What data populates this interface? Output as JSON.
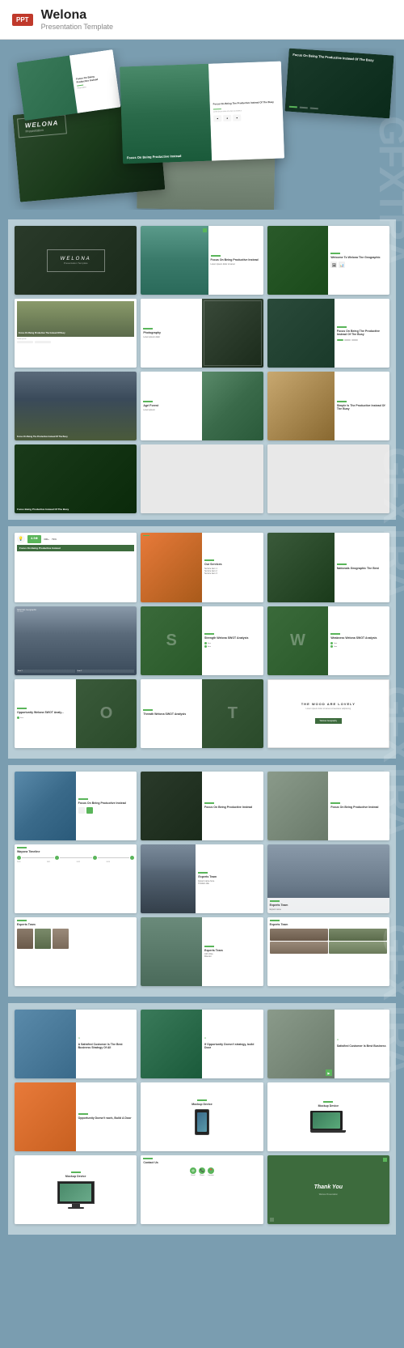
{
  "header": {
    "badge": "PPT",
    "title": "Welona",
    "subtitle": "Presentation Template"
  },
  "watermarks": {
    "section1": "GFXTRA",
    "section2": "GFXTRA",
    "section3": "GFXTRA",
    "section4": "GFXTRA"
  },
  "slides": {
    "cover": {
      "brand": "WELONA",
      "tagline": "Presentation Template"
    },
    "slide1_title": "Focus On Being Productive Instead",
    "slide2_title": "Welcome To Welona The Geographic",
    "slide3_title": "Focus On Being The Productive Instead Of The Busy",
    "slide4_title": "Focus On Being Productive Instead",
    "slide5_title": "Nationals Geographic The Best",
    "slide6_title": "Simple Is The Productive Instead Of The Busy",
    "slide7_title": "Focus Being Productive Instead Of The Busy",
    "swot_strength": "Strength Welona SWOT Analysis",
    "swot_weakness": "Weakness Welona SWOT Analysis",
    "swot_opportunity": "Opportunity Welona SWOT Analy...",
    "swot_threat": "Threath Welona SWOT Analysis",
    "swot_quote": "THE WOOD ARE LOVELY",
    "timeline_title": "Wayona Timeline",
    "team_title": "Experts Team",
    "team2_title": "Experts Team",
    "team3_title": "Experts Team",
    "team4_title": "Experts Team",
    "team5_title": "Experts Team",
    "testimonial1": "A Satisfied Customer Is The Best Business Strategy Of All",
    "testimonial2": "If Opportunity Doesn't strategy, build Door",
    "testimonial3": "Satisfied Customer Is Best Business",
    "opportunity2": "Opportunity Doesn't work, Build A Door",
    "contact_title": "Contact Us",
    "thank_you": "Thank You",
    "mockup1": "Mockup Device",
    "mockup2": "Mockup Device",
    "mockup3": "Mockup Device",
    "services_title": "Our Services",
    "nationals_title": "Nationals Geographic The Best"
  }
}
